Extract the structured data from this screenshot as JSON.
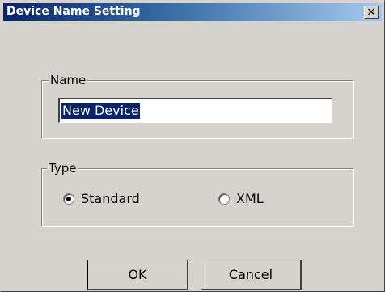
{
  "window": {
    "title": "Device Name Setting",
    "close_glyph": "✕"
  },
  "name_group": {
    "label": "Name",
    "input_value": "New Device"
  },
  "type_group": {
    "label": "Type",
    "options": [
      {
        "label": "Standard",
        "selected": true
      },
      {
        "label": "XML",
        "selected": false
      }
    ]
  },
  "buttons": {
    "ok": "OK",
    "cancel": "Cancel"
  }
}
